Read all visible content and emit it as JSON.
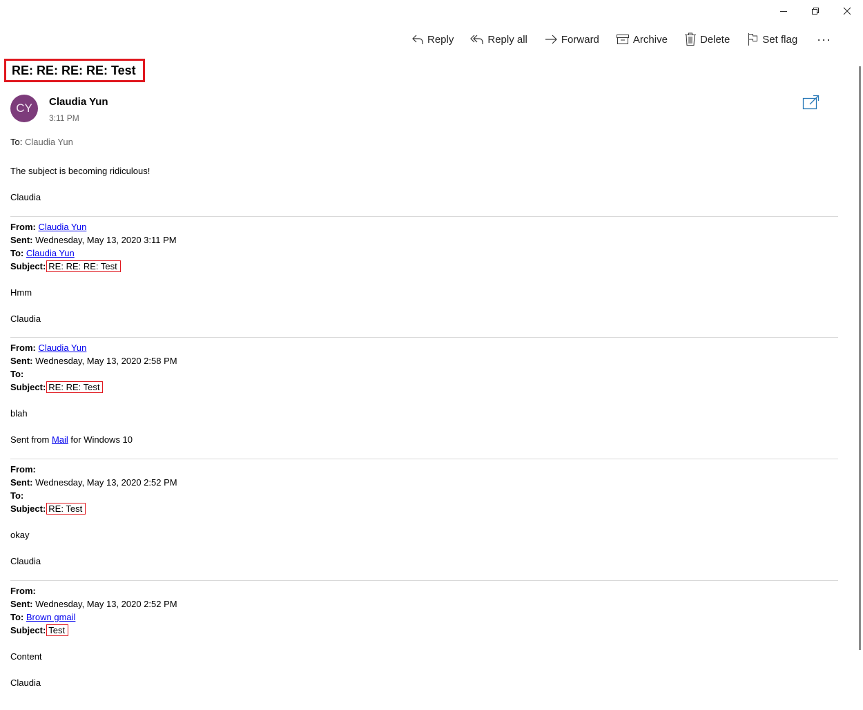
{
  "toolbar": {
    "reply": "Reply",
    "reply_all": "Reply all",
    "forward": "Forward",
    "archive": "Archive",
    "delete": "Delete",
    "set_flag": "Set flag",
    "more": "···"
  },
  "message": {
    "subject": "RE: RE: RE: RE: Test",
    "avatar_initials": "CY",
    "avatar_color": "#7d3c7b",
    "sender_name": "Claudia Yun",
    "time": "3:11 PM",
    "to_label": "To:",
    "to_value": "Claudia Yun",
    "body_line1": "The subject is becoming ridiculous!",
    "body_sign": "Claudia"
  },
  "labels": {
    "from": "From:",
    "sent": "Sent:",
    "to": "To:",
    "subject": "Subject:"
  },
  "quoted": [
    {
      "from": "Claudia Yun",
      "sent": "Wednesday, May 13, 2020 3:11 PM",
      "to": "Claudia Yun",
      "subject": "RE: RE: RE: Test",
      "body": "Hmm",
      "sign": "Claudia"
    },
    {
      "from": "Claudia Yun",
      "sent": "Wednesday, May 13, 2020 2:58 PM",
      "to": "",
      "subject": "RE: RE: Test",
      "body": "blah",
      "sign_prefix": "Sent from ",
      "sign_link": "Mail",
      "sign_suffix": " for Windows 10"
    },
    {
      "from": "",
      "sent": "Wednesday, May 13, 2020 2:52 PM",
      "to": "",
      "subject": "RE: Test",
      "body": "okay",
      "sign": "Claudia"
    },
    {
      "from": "",
      "sent": "Wednesday, May 13, 2020 2:52 PM",
      "to": "Brown gmail",
      "subject": "Test",
      "body": "Content",
      "sign": "Claudia"
    }
  ],
  "colors": {
    "highlight_red": "#e0181f",
    "link_blue": "#0000ee",
    "popout_blue": "#2a7ab8"
  }
}
